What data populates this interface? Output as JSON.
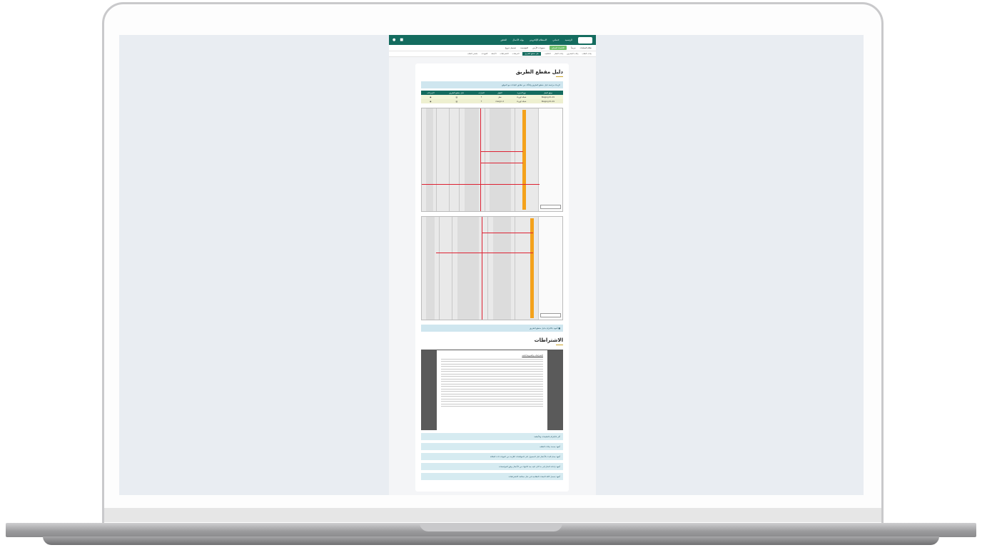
{
  "app": {
    "logo_text": "نافس",
    "topnav": [
      "الرئيسية",
      "خدماتي",
      "الاستعلام الإلكتروني",
      "بوابة الأعمال",
      "التحقق"
    ],
    "subbar": {
      "title": "نظام العمليات",
      "user": "مرحباً",
      "button": "الاقتصاد المحلي",
      "items": [
        "حجوزات الأرض",
        "المؤسسة",
        "تسجيل خروج"
      ]
    },
    "tabs": [
      "بيانات الطلب",
      "بيانات المشروع",
      "بيانات العقار",
      "التكاليف",
      "دليل مقطع الطريق",
      "المرفقات",
      "الاشتراطات",
      "الأسئلة",
      "التعهدات",
      "ملخص الطلب"
    ],
    "active_tab": "دليل مقطع الطريق"
  },
  "section_road": {
    "title": "دليل مقطع الطريق",
    "info": "الرجاء مراجعة دليل مقطع الطريق والتأكد من تطابق البيانات مع الموقع",
    "table": {
      "headers": [
        "موقع العمل",
        "نوع الحفرية",
        "الطول",
        "الحارات",
        "دليل مقطع الطريق",
        "الإجراءات"
      ],
      "rows": [
        [
          "Staging 01-01",
          "شبكة كهرباء",
          "نشل",
          "٣",
          "",
          ""
        ],
        [
          "Staging 01-01",
          "شبكة كهرباء",
          "2 mergin",
          "٣",
          "",
          ""
        ]
      ]
    },
    "checkbox_label": "أتعهد بالالتزام بدليل مقطع الطريق"
  },
  "section_terms": {
    "title": "الاشتراطات",
    "doc_heading": "الاشتراطات والشروط العامة",
    "accordion": [
      "أقر بالإلتزام بالتعليمات والأنظمة",
      "أتعهد بصحة بيانات الطلب",
      "أتعهد بعدم البدء بالأعمال قبل الحصول على الموافقات اللازمة من الجهات ذات العلاقة",
      "أتعهد بإعادة الحال إلى ما كان عليه بعد الانتهاء من الأعمال وفق المواصفات",
      "أتعهد بتحمل كافة التبعات النظامية في حال مخالفة الاشتراطات"
    ]
  },
  "colors": {
    "brand": "#146c5f",
    "accent": "#f4a21c",
    "info_bg": "#cfe6ef"
  }
}
